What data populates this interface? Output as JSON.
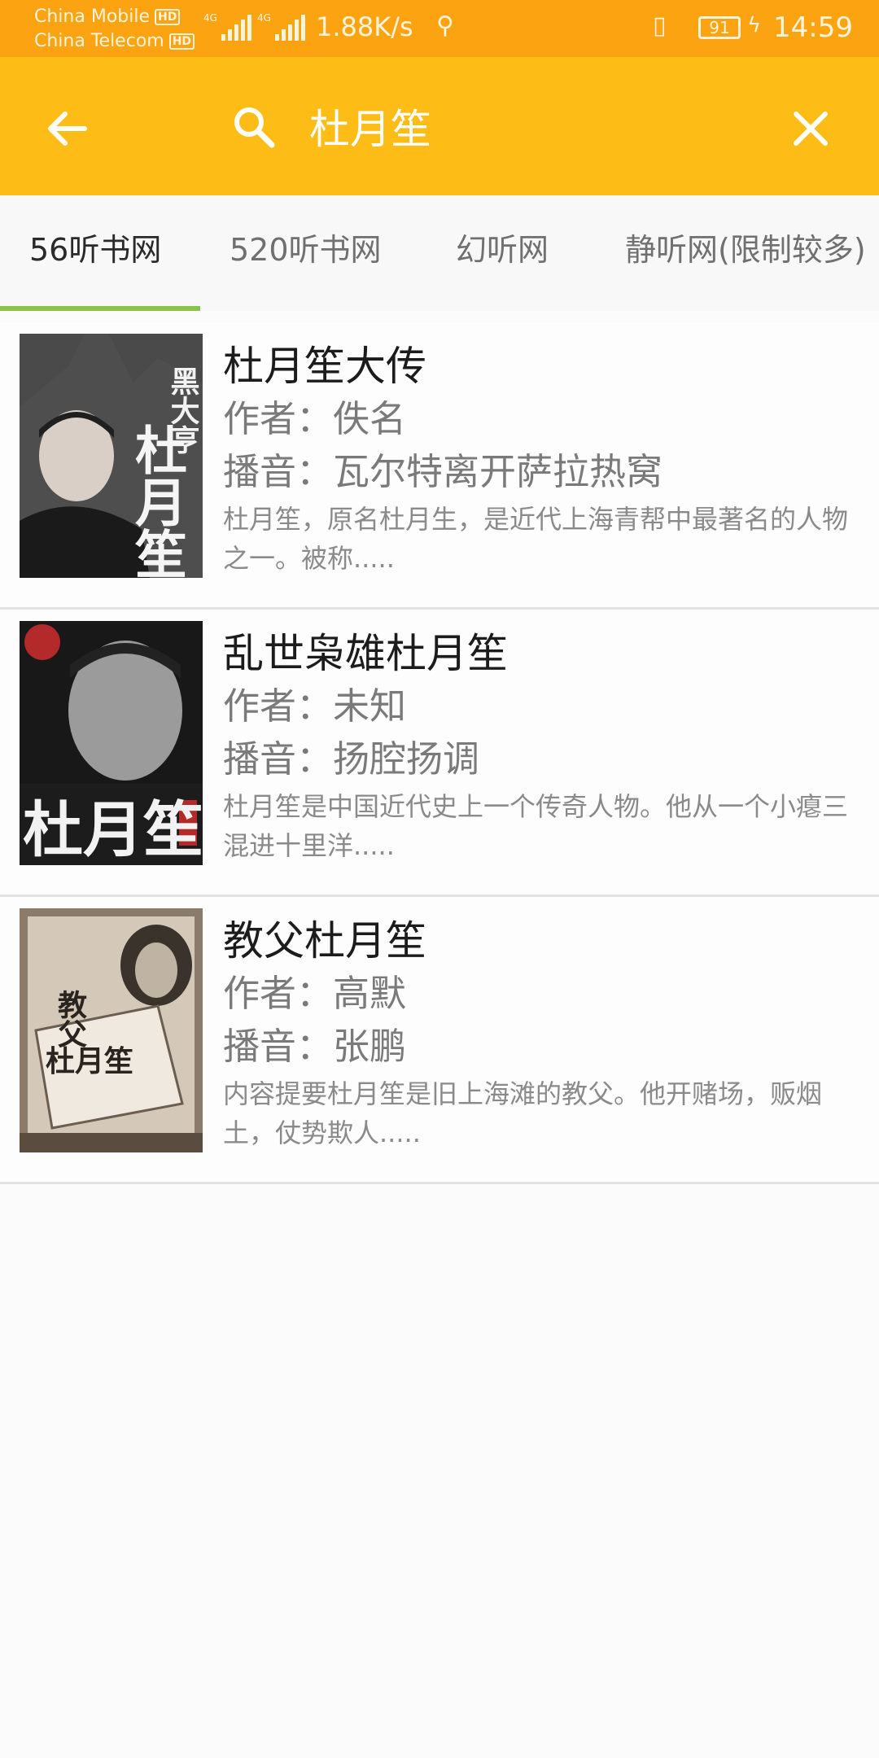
{
  "status_bar": {
    "carrier1": "China Mobile",
    "carrier2": "China Telecom",
    "hd": "HD",
    "net1": "4G",
    "net2": "4G",
    "speed": "1.88K/s",
    "battery": "91",
    "time": "14:59"
  },
  "search": {
    "query": "杜月笙"
  },
  "tabs": [
    "56听书网",
    "520听书网",
    "幻听网",
    "静听网(限制较多)"
  ],
  "results": [
    {
      "title": "杜月笙大传",
      "author": "作者：佚名",
      "narrator": "播音：瓦尔特离开萨拉热窝",
      "desc": "杜月笙，原名杜月生，是近代上海青帮中最著名的人物之一。被称.....",
      "cover_text": [
        "黑大亨",
        "杜月笙"
      ]
    },
    {
      "title": "乱世枭雄杜月笙",
      "author": "作者：未知",
      "narrator": "播音：扬腔扬调",
      "desc": "杜月笙是中国近代史上一个传奇人物。他从一个小瘪三混进十里洋.....",
      "cover_text": [
        "杜月笙"
      ]
    },
    {
      "title": "教父杜月笙",
      "author": "作者：高默",
      "narrator": "播音：张鹏",
      "desc": "内容提要杜月笙是旧上海滩的教父。他开赌场，贩烟土，仗势欺人.....",
      "cover_text": [
        "教父",
        "杜月笙"
      ]
    }
  ],
  "colors": {
    "status_bar": "#fca311",
    "app_bar": "#fdbd16",
    "tab_indicator": "#8bc34a"
  }
}
